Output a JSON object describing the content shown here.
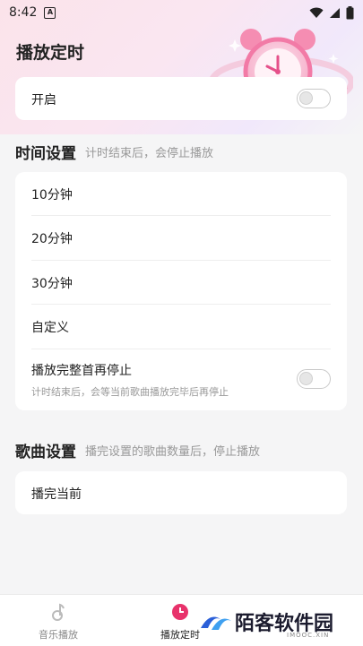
{
  "statusbar": {
    "time": "8:42",
    "app_icon": "A"
  },
  "header": {
    "title": "播放定时"
  },
  "toggle_card": {
    "label": "开启",
    "enabled": false
  },
  "time_section": {
    "title": "时间设置",
    "subtitle": "计时结束后，会停止播放",
    "options": [
      "10分钟",
      "20分钟",
      "30分钟",
      "自定义"
    ],
    "finish_option": {
      "label": "播放完整首再停止",
      "description": "计时结束后，会等当前歌曲播放完毕后再停止",
      "enabled": false
    }
  },
  "song_section": {
    "title": "歌曲设置",
    "subtitle": "播完设置的歌曲数量后，停止播放",
    "option": "播完当前"
  },
  "bottom_nav": {
    "items": [
      {
        "label": "音乐播放",
        "icon": "music-note-icon"
      },
      {
        "label": "播放定时",
        "icon": "timer-icon"
      }
    ]
  },
  "watermark": {
    "text": "陌客软件园",
    "sub": "IMOOC.XIN"
  },
  "colors": {
    "accent": "#f25a8c",
    "toggle_off": "#c9c9c9"
  }
}
